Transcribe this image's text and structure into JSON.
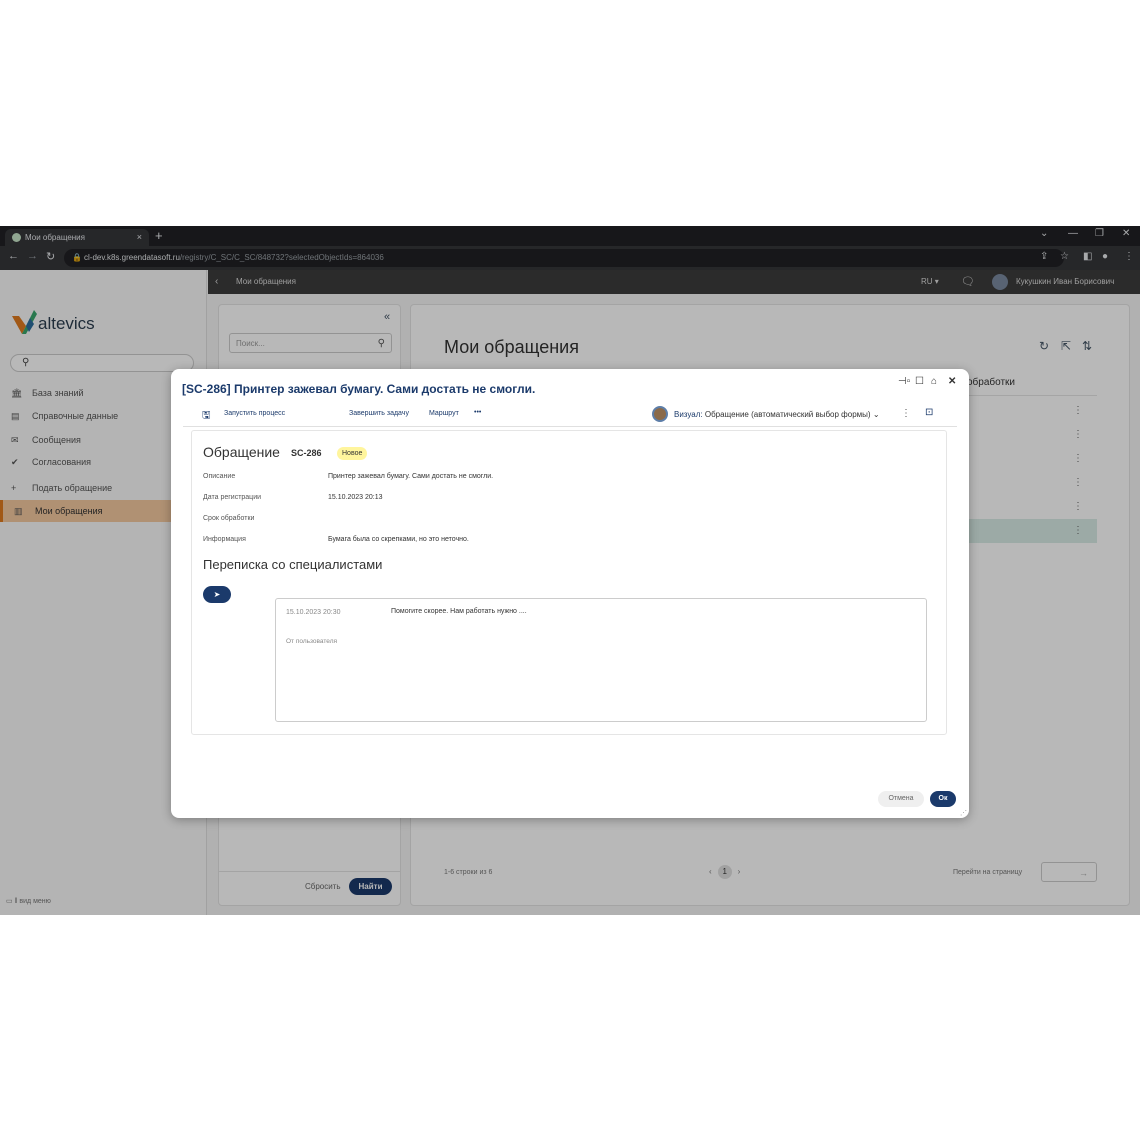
{
  "browser": {
    "tab_title": "Мои обращения",
    "tab_close": "×",
    "new_tab": "+",
    "url_host": "cl-dev.k8s.greendatasoft.ru",
    "url_path": "/registry/C_SC/C_SC/848732?selectedObjectIds=864036"
  },
  "app": {
    "logo_text": "altevics",
    "topnav_title": "Мои обращения",
    "language": "RU ▾",
    "user_name": "Кукушкин Иван Борисович",
    "sidebar": {
      "items": [
        {
          "label": "База знаний",
          "icon": "bank-icon"
        },
        {
          "label": "Справочные данные",
          "icon": "book-icon"
        },
        {
          "label": "Сообщения",
          "icon": "mail-icon"
        },
        {
          "label": "Согласования",
          "icon": "check-icon"
        },
        {
          "label": "Подать обращение",
          "icon": "plus-icon"
        },
        {
          "label": "Мои обращения",
          "icon": "list-icon"
        }
      ],
      "footer": "вид меню"
    },
    "filter": {
      "search_placeholder": "Поиск...",
      "reset_label": "Сбросить",
      "find_label": "Найти"
    },
    "main": {
      "title": "Мои обращения",
      "column_header": "обработки",
      "rows_count": "1-6 строки из 6",
      "current_page": "1",
      "goto_label": "Перейти на страницу",
      "goto_arrow": "→"
    }
  },
  "dialog": {
    "title": "[SC-286] Принтер зажевал бумагу. Сами достать не смогли.",
    "toolbar": {
      "start_process": "Запустить процесс",
      "finish_task": "Завершить задачу",
      "route": "Маршрут",
      "more": "•••",
      "visual_label": "Визуал:",
      "visual_value": "Обращение (автоматический выбор формы)"
    },
    "form": {
      "title": "Обращение",
      "id": "SC-286",
      "status": "Новое",
      "fields": [
        {
          "label": "Описание",
          "value": "Принтер зажевал бумагу. Сами достать не смогли."
        },
        {
          "label": "Дата регистрации",
          "value": "15.10.2023 20:13"
        },
        {
          "label": "Срок обработки",
          "value": ""
        },
        {
          "label": "Информация",
          "value": "Бумага была со скрепками, но это неточно."
        }
      ]
    },
    "correspondence": {
      "title": "Переписка со специалистами",
      "message_time": "15.10.2023 20:30",
      "message_text": "Помогите скорее. Нам работать нужно ....",
      "message_author": "От пользователя"
    },
    "cancel_label": "Отмена",
    "ok_label": "Ок"
  }
}
